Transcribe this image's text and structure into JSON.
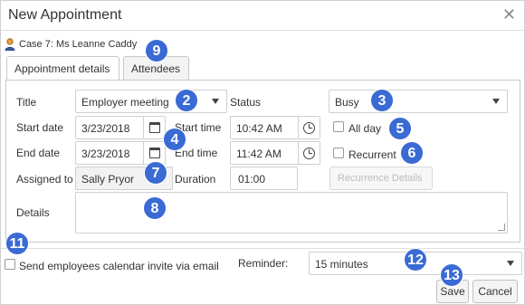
{
  "dialog": {
    "title": "New Appointment"
  },
  "case": {
    "label": "Case 7: Ms Leanne Caddy"
  },
  "tabs": [
    {
      "label": "Appointment details",
      "active": true
    },
    {
      "label": "Attendees",
      "active": false
    }
  ],
  "form": {
    "title_label": "Title",
    "title_value": "Employer meeting",
    "status_label": "Status",
    "status_value": "Busy",
    "start_date_label": "Start date",
    "start_date_value": "3/23/2018",
    "start_time_label": "Start time",
    "start_time_value": "10:42 AM",
    "all_day_label": "All day",
    "end_date_label": "End date",
    "end_date_value": "3/23/2018",
    "end_time_label": "End time",
    "end_time_value": "11:42 AM",
    "recurrent_label": "Recurrent",
    "assigned_to_label": "Assigned to",
    "assigned_to_value": "Sally Pryor",
    "duration_label": "Duration",
    "duration_value": "01:00",
    "recurrence_button": "Recurrence Details",
    "details_label": "Details"
  },
  "footer": {
    "invite_label": "Send employees calendar invite via email",
    "reminder_label": "Reminder:",
    "reminder_value": "15 minutes",
    "save_label": "Save",
    "cancel_label": "Cancel"
  },
  "badges": [
    "2",
    "3",
    "4",
    "5",
    "6",
    "7",
    "8",
    "9",
    "11",
    "12",
    "13"
  ],
  "colors": {
    "badge": "#3a6ad4",
    "border": "#cfcfcf"
  }
}
